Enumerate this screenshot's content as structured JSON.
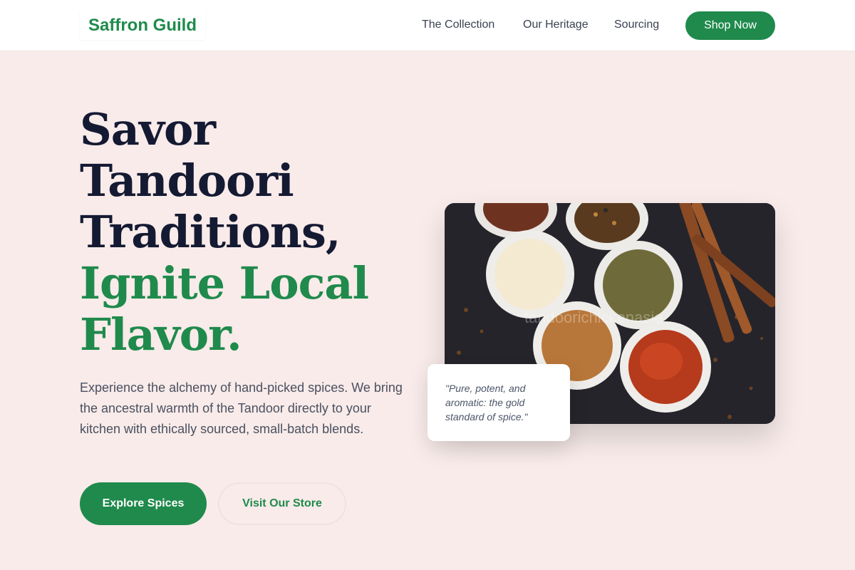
{
  "header": {
    "logo": "Saffron Guild",
    "nav": [
      "The Collection",
      "Our Heritage",
      "Sourcing"
    ],
    "cta": "Shop Now"
  },
  "hero": {
    "title_lines_dark": [
      "Savor",
      "Tandoori",
      "Traditions,"
    ],
    "title_lines_green": [
      "Ignite Local",
      "Flavor."
    ],
    "description": "Experience the alchemy of hand-picked spices. We bring the ancestral warmth of the Tandoor directly to your kitchen with ethically sourced, small-batch blends.",
    "primary_button": "Explore Spices",
    "secondary_button": "Visit Our Store"
  },
  "image": {
    "watermark": "tandoorichickenasia"
  },
  "quote": {
    "text": "\"Pure, potent, and aromatic: the gold standard of spice.\""
  },
  "colors": {
    "brand_green": "#1f8a4c",
    "background": "#f8ebe9",
    "heading_dark": "#151a33"
  },
  "icons": []
}
